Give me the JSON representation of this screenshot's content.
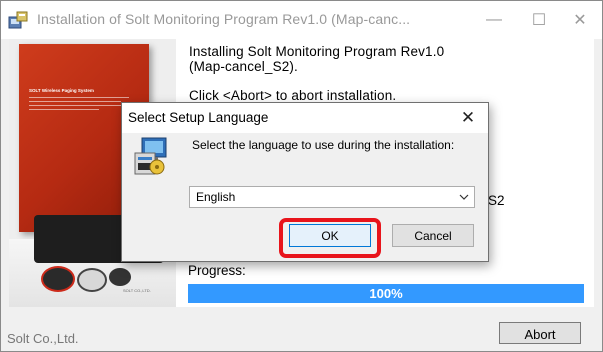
{
  "window": {
    "title": "Installation of Solt Monitoring Program Rev1.0 (Map-canc...",
    "minimize_glyph": "—",
    "maximize_glyph": "☐",
    "close_glyph": "✕"
  },
  "installer": {
    "line1": "Installing Solt Monitoring Program Rev1.0",
    "line2": "(Map-cancel_S2).",
    "line3": "Click <Abort> to abort installation.",
    "behind_dialog_fragment": "S2",
    "progress_label": "Progress:",
    "progress_value": 100,
    "progress_text": "100%",
    "company": "Solt Co.,Ltd.",
    "abort_label": "Abort"
  },
  "product_image": {
    "cover_title": "SOLT Wireless Paging System",
    "base_caption": "SOLT CO.,LTD."
  },
  "dialog": {
    "title": "Select Setup Language",
    "close_glyph": "✕",
    "prompt": "Select the language to use during the installation:",
    "language_value": "English",
    "ok_label": "OK",
    "cancel_label": "Cancel"
  },
  "colors": {
    "progress_fill": "#3399ff",
    "highlight": "#e8141b",
    "focus_border": "#0078d7"
  },
  "icons": {
    "app_icon": "installer-icon",
    "setup_icon": "setup-language-icon",
    "dropdown_icon": "chevron-down-icon"
  }
}
